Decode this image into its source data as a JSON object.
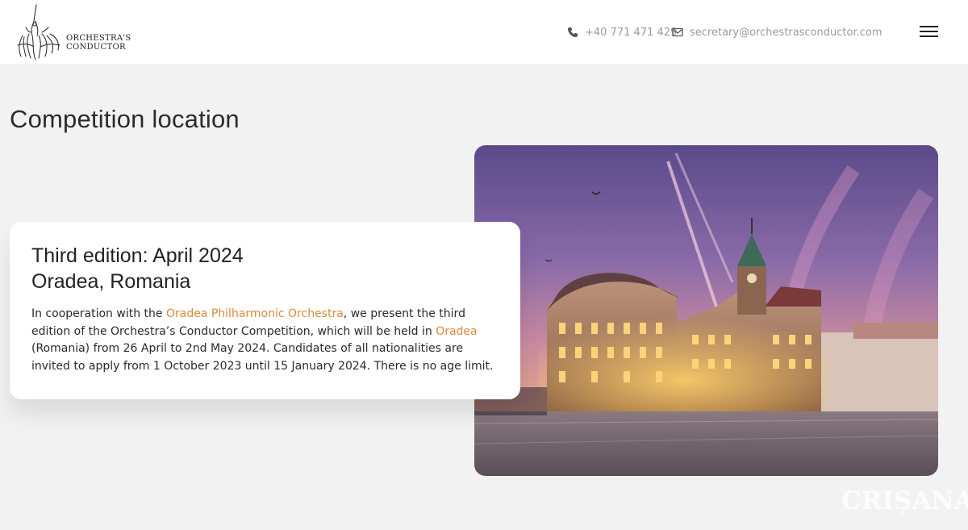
{
  "header": {
    "logo_line1": "ORCHESTRA'S",
    "logo_line2": "CONDUCTOR",
    "phone": "+40 771 471 429",
    "email": "secretary@orchestrasconductor.com",
    "icons": [
      "phone-icon",
      "envelope-icon",
      "hamburger-menu-icon"
    ]
  },
  "main": {
    "title": "Competition location",
    "card": {
      "heading_line1": "Third edition: April 2024",
      "heading_line2": "Oradea, Romania",
      "body_part1": "In cooperation with the ",
      "link1": "Oradea Philharmonic Orchestra",
      "body_part2": ", we present the third edition of the Orchestra’s Conductor Competition, which will be held in ",
      "link2": "Oradea",
      "body_part3": " (Romania) from 26 April to 2nd May 2024. Candidates of all nationalities are invited to apply from 1 October 2023 until 15 January 2024. There is no age limit."
    },
    "watermark": "CRIȘANA"
  },
  "colors": {
    "background": "#f2f2f2",
    "link": "#d98a3a",
    "contact_text": "#9a9a9a"
  }
}
